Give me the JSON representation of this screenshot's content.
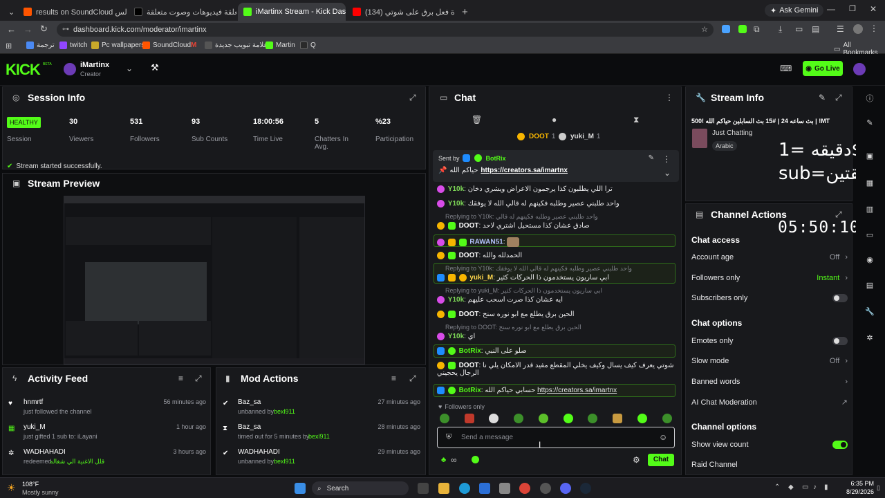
{
  "browser": {
    "tabs": [
      {
        "label": "results on SoundCloud الاندلس",
        "color": "#ff5500"
      },
      {
        "label": "متعلقة فيديوهات وصوت متعلقة...",
        "color": "#111111"
      },
      {
        "label": "iMartinx Stream - Kick Dashboa",
        "color": "#53fc18"
      },
      {
        "label": "(134) ردة فعل برق على شوتي (...",
        "color": "#ff0000"
      }
    ],
    "gemini_label": "Ask Gemini",
    "url": "dashboard.kick.com/moderator/imartinx",
    "bookmarks": [
      "ترجمة",
      "twitch",
      "Pc wallpapers",
      "SoundCloud",
      "M",
      "علامة تبويب جديدة",
      "Martin",
      "Q"
    ],
    "all_bookmarks": "All Bookmarks"
  },
  "header": {
    "logo": "KICK",
    "logo_tag": "BETA",
    "channel_name": "iMartinx",
    "channel_role": "Creator",
    "go_live": "Go Live",
    "accent": "#53fc18"
  },
  "session": {
    "title": "Session Info",
    "status": "HEALTHY",
    "session_label": "Session",
    "stats": [
      {
        "value": "30",
        "label": "Viewers"
      },
      {
        "value": "531",
        "label": "Followers"
      },
      {
        "value": "93",
        "label": "Sub Counts"
      },
      {
        "value": "18:00:56",
        "label": "Time Live"
      },
      {
        "value": "5",
        "label": "Chatters In Avg."
      },
      {
        "value": "%23",
        "label": "Participation"
      }
    ],
    "message": "Stream started successfully."
  },
  "preview": {
    "title": "Stream Preview"
  },
  "activity": {
    "title": "Activity Feed",
    "items": [
      {
        "user": "hnmrtf",
        "text": "just followed the channel",
        "time": "56 minutes ago",
        "icon": "heart-icon"
      },
      {
        "user": "yuki_M",
        "text": "just gifted 1 sub to: iLayani",
        "time": "1 hour ago",
        "icon": "gift-icon"
      },
      {
        "user": "WADHAHADI",
        "text": "redeemed",
        "extra": "قلل الاغنية الي شغاله",
        "time": "3 hours ago",
        "icon": "points-icon"
      }
    ]
  },
  "mod": {
    "title": "Mod Actions",
    "items": [
      {
        "user": "Baz_sa",
        "text": "unbanned by",
        "by": "bexl911",
        "time": "27 minutes ago"
      },
      {
        "user": "Baz_sa",
        "text": "timed out for 5 minutes by",
        "by": "bexl911",
        "time": "28 minutes ago"
      },
      {
        "user": "WADHAHADI",
        "text": "unbanned by",
        "by": "bexl911",
        "time": "29 minutes ago"
      }
    ]
  },
  "chat": {
    "title": "Chat",
    "top_users": [
      {
        "name": "DOOT",
        "count": "1"
      },
      {
        "name": "yuki_M",
        "count": "1"
      }
    ],
    "pinned": {
      "sent_by": "Sent by",
      "user": "BotRix",
      "text": "حياكم الله",
      "link": "https://creators.sa/imartnx"
    },
    "messages": [
      {
        "user": "Y10k",
        "text": "ترا اللي يطلبون كذا يرجمون الاعراض ويشري دخان",
        "color": "#7ed957"
      },
      {
        "user": "Y10k",
        "text": "واحد طلبني عصير وطلبه فكينهم له قالي الله لا يوفقك",
        "color": "#7ed957"
      },
      {
        "reply": "Replying to Y10k: واحد طلبني عصير وطلبه فكينهم له قالي",
        "user": "DOOT",
        "text": "صادق عشان كذا مستحيل اشتري لاحد",
        "color": "#ffffff"
      },
      {
        "user": "RAWAN51",
        "text": "",
        "color": "#b6c3ff"
      },
      {
        "user": "DOOT",
        "text": "الحمدلله والله",
        "color": "#ffffff"
      },
      {
        "reply": "Replying to Y10k: واحد طلبني عصير وطلبه فكينهم له قالي الله لا يوفقك",
        "user": "yuki_M",
        "text": "ابي ساريون يستخدمون ذا الحركات كثير",
        "color": "#ffd84d"
      },
      {
        "reply": "Replying to yuki_M: ابي ساريون يستخدمون ذا الحركات كثير",
        "user": "Y10k",
        "text": "ايه عشان كذا صرت اسحب عليهم",
        "color": "#7ed957"
      },
      {
        "user": "DOOT",
        "text": "الحين برق يطلع مع ابو نوره سنح",
        "color": "#ffffff"
      },
      {
        "reply": "Replying to DOOT: الحين برق يطلع مع ابو نوره سنح",
        "user": "Y10k",
        "text": "اي",
        "color": "#7ed957"
      },
      {
        "user": "BotRix",
        "text": "صلو على النبي",
        "color": "#53fc18"
      },
      {
        "user": "DOOT",
        "text": "شوتي يعرف كيف يسال وكيف يخلي المقطع مفيد قدر الامكان يلي نا الرجال يحجيني",
        "color": "#ffffff"
      },
      {
        "user": "BotRix",
        "text": "حسابي حياكم الله",
        "link": "https://creators.sa/imartnx",
        "color": "#53fc18"
      }
    ],
    "followers_only": "Followers only",
    "placeholder": "Send a message",
    "send": "Chat"
  },
  "stream_info": {
    "title": "Stream Info",
    "stream_title": "بث ساعه 24 | #15 بث السابلين حياكم الله !500 | !MT",
    "category": "Just Chatting",
    "language": "Arabic",
    "overlay_lines": [
      "دقيقه =1$",
      "sub=دقيقتين"
    ],
    "overlay_timer": "05:50:10"
  },
  "channel_actions": {
    "title": "Channel Actions",
    "chat_access": "Chat access",
    "account_age": "Account age",
    "account_age_value": "Off",
    "followers_only": "Followers only",
    "followers_only_value": "Instant",
    "subscribers_only": "Subscribers only",
    "chat_options": "Chat options",
    "emotes_only": "Emotes only",
    "slow_mode": "Slow mode",
    "slow_mode_value": "Off",
    "banned_words": "Banned words",
    "ai_moderation": "AI Chat Moderation",
    "channel_options": "Channel options",
    "show_view_count": "Show view count",
    "raid_channel": "Raid Channel"
  },
  "taskbar": {
    "weather_temp": "108°F",
    "weather_text": "Mostly sunny",
    "search": "Search",
    "time": "6:35 PM",
    "date": "8/29/2026"
  }
}
